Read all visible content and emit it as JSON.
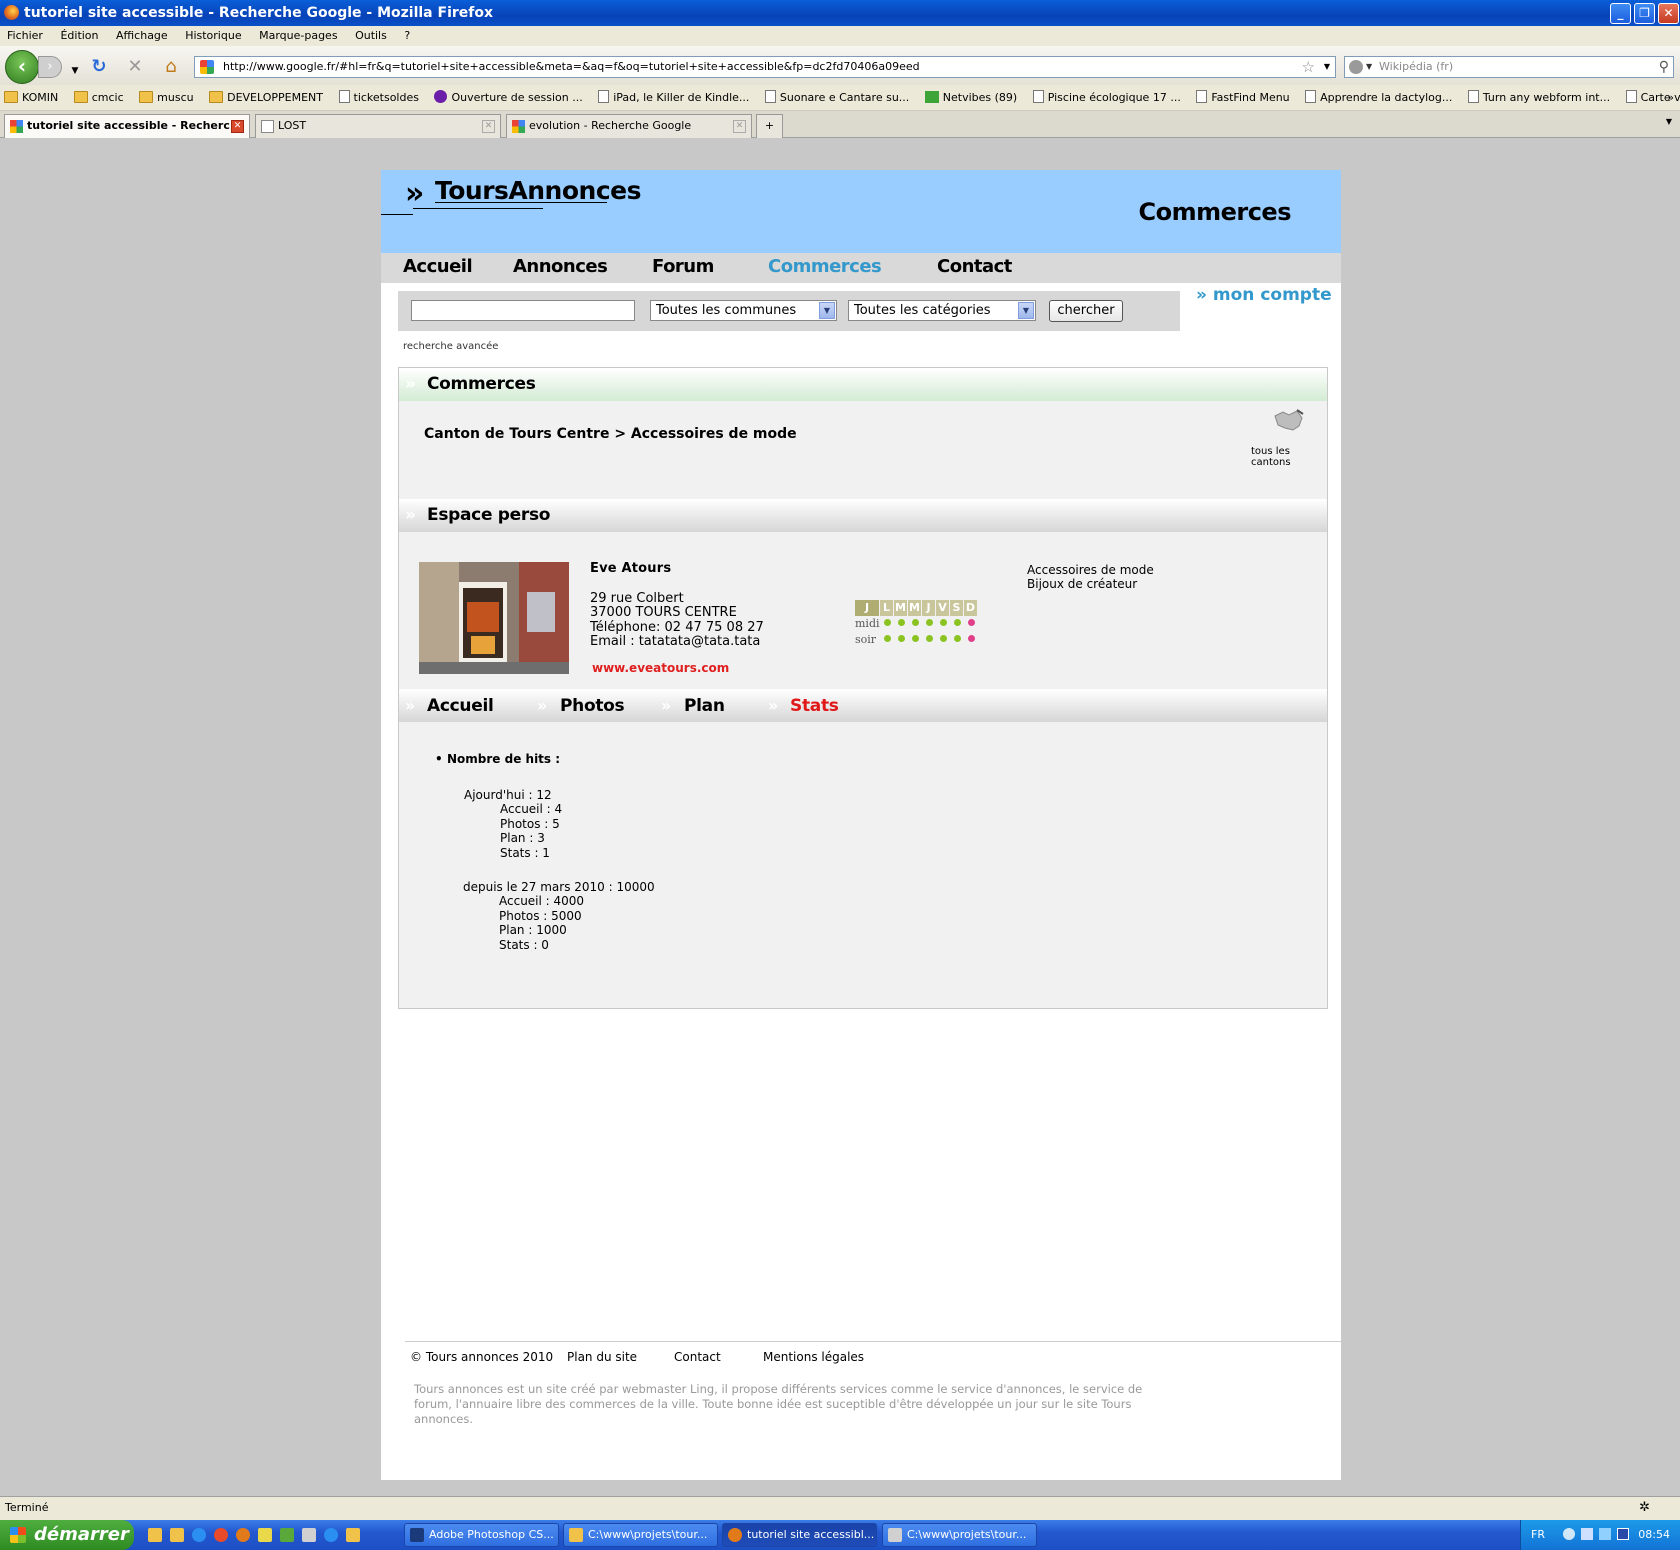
{
  "window": {
    "title": "tutoriel site accessible - Recherche Google - Mozilla Firefox"
  },
  "menu": [
    "Fichier",
    "Édition",
    "Affichage",
    "Historique",
    "Marque-pages",
    "Outils",
    "?"
  ],
  "url": "http://www.google.fr/#hl=fr&q=tutoriel+site+accessible&meta=&aq=f&oq=tutoriel+site+accessible&fp=dc2fd70406a09eed",
  "search_placeholder": "Wikipédia (fr)",
  "bookmarks": [
    "KOMIN",
    "cmcic",
    "muscu",
    "DEVELOPPEMENT",
    "ticketsoldes",
    "Ouverture de session ...",
    "iPad, le Killer de Kindle...",
    "Suonare e Cantare su...",
    "Netvibes (89)",
    "Piscine écologique 17 ...",
    "FastFind Menu",
    "Apprendre la dactylog...",
    "Turn any webform int...",
    "Carte vectorielle grat..."
  ],
  "tabs": [
    {
      "label": "tutoriel site accessible - Recherc...",
      "active": true
    },
    {
      "label": "LOST",
      "active": false
    },
    {
      "label": "evolution - Recherche Google",
      "active": false
    }
  ],
  "site": {
    "logo": "ToursAnnonces",
    "header_title": "Commerces",
    "nav": [
      "Accueil",
      "Annonces",
      "Forum",
      "Commerces",
      "Contact"
    ],
    "nav_current": "Commerces",
    "search": {
      "communes": "Toutes les communes",
      "categories": "Toutes les catégories",
      "button": "chercher",
      "advanced": "recherche avancée"
    },
    "account": "mon compte",
    "section_commerces": "Commerces",
    "breadcrumb": "Canton de Tours Centre > Accessoires de mode",
    "cantons_label": "tous les cantons",
    "section_espace": "Espace perso",
    "shop": {
      "name": "Eve Atours",
      "address1": "29 rue Colbert",
      "address2": "37000 TOURS CENTRE",
      "phone": "Téléphone: 02 47 75 08 27",
      "email": "Email : tatatata@tata.tata",
      "website": "www.eveatours.com",
      "categories": [
        "Accessoires de mode",
        "Bijoux de créateur"
      ]
    },
    "hours": {
      "days": [
        "J",
        "L",
        "M",
        "M",
        "J",
        "V",
        "S",
        "D"
      ],
      "midi_label": "midi",
      "soir_label": "soir",
      "midi": [
        "open",
        "open",
        "open",
        "open",
        "open",
        "open",
        "closed"
      ],
      "soir": [
        "open",
        "open",
        "open",
        "open",
        "open",
        "open",
        "closed"
      ]
    },
    "subnav": [
      "Accueil",
      "Photos",
      "Plan",
      "Stats"
    ],
    "subnav_current": "Stats",
    "stats": {
      "title": "Nombre de hits :",
      "today": "Ajourd'hui : 12",
      "today_items": [
        "Accueil : 4",
        "Photos : 5",
        "Plan : 3",
        "Stats : 1"
      ],
      "since": "depuis le 27 mars 2010 : 10000",
      "since_items": [
        "Accueil : 4000",
        "Photos : 5000",
        "Plan : 1000",
        "Stats : 0"
      ]
    },
    "footer": {
      "links": [
        "© Tours annonces 2010",
        "Plan du site",
        "Contact",
        "Mentions légales"
      ],
      "text": "Tours annonces est un site créé par webmaster Ling, il propose différents services comme le service d'annonces, le service de forum, l'annuaire libre des commerces de la ville. Toute bonne idée est suceptible d'être développée un jour sur le site Tours annonces."
    }
  },
  "status": "Terminé",
  "taskbar": {
    "start": "démarrer",
    "items": [
      {
        "label": "Adobe Photoshop CS...",
        "active": false
      },
      {
        "label": "C:\\www\\projets\\tour...",
        "active": false
      },
      {
        "label": "tutoriel site accessibl...",
        "active": true
      },
      {
        "label": "C:\\www\\projets\\tour...",
        "active": false
      }
    ],
    "lang": "FR",
    "clock": "08:54"
  }
}
